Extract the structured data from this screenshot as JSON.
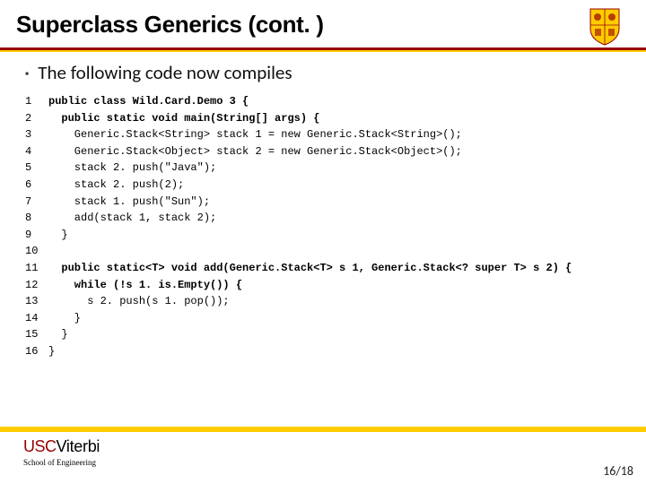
{
  "header": {
    "title": "Superclass Generics (cont. )"
  },
  "bullet": {
    "text": "The following code now compiles"
  },
  "code": {
    "lines": [
      {
        "n": "1",
        "t": "public class Wild.Card.Demo 3 {",
        "bold": true
      },
      {
        "n": "2",
        "t": "  public static void main(String[] args) {",
        "bold": true
      },
      {
        "n": "3",
        "t": "    Generic.Stack<String> stack 1 = new Generic.Stack<String>();",
        "bold": false
      },
      {
        "n": "4",
        "t": "    Generic.Stack<Object> stack 2 = new Generic.Stack<Object>();",
        "bold": false
      },
      {
        "n": "5",
        "t": "    stack 2. push(\"Java\");",
        "bold": false
      },
      {
        "n": "6",
        "t": "    stack 2. push(2);",
        "bold": false
      },
      {
        "n": "7",
        "t": "    stack 1. push(\"Sun\");",
        "bold": false
      },
      {
        "n": "8",
        "t": "    add(stack 1, stack 2);",
        "bold": false
      },
      {
        "n": "9",
        "t": "  }",
        "bold": false
      },
      {
        "n": "10",
        "t": "",
        "bold": false
      },
      {
        "n": "11",
        "t": "  public static<T> void add(Generic.Stack<T> s 1, Generic.Stack<? super T> s 2) {",
        "bold": true
      },
      {
        "n": "12",
        "t": "    while (!s 1. is.Empty()) {",
        "bold": true
      },
      {
        "n": "13",
        "t": "      s 2. push(s 1. pop());",
        "bold": false
      },
      {
        "n": "14",
        "t": "    }",
        "bold": false
      },
      {
        "n": "15",
        "t": "  }",
        "bold": false
      },
      {
        "n": "16",
        "t": "}",
        "bold": false
      }
    ]
  },
  "footer": {
    "usc": "USC",
    "viterbi": "Viterbi",
    "school": "School of Engineering",
    "page": "16/18"
  },
  "colors": {
    "cardinal": "#990000",
    "gold": "#FFCC00"
  }
}
